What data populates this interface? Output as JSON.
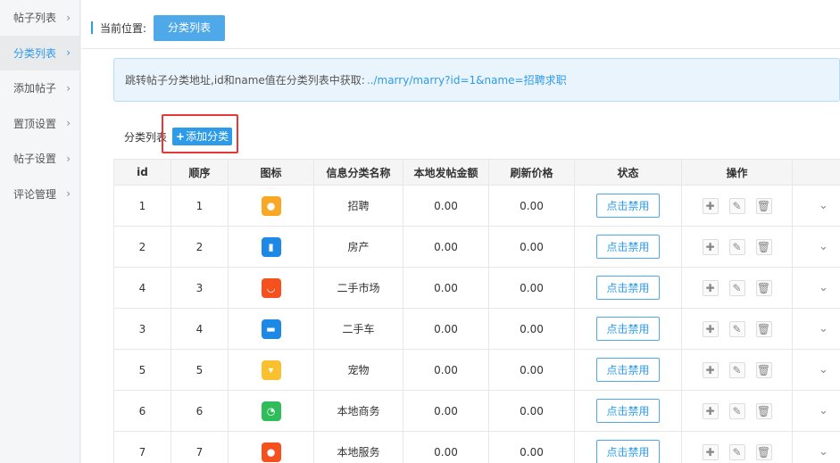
{
  "sidebar": {
    "items": [
      {
        "label": "帖子列表",
        "active": false
      },
      {
        "label": "分类列表",
        "active": true
      },
      {
        "label": "添加帖子",
        "active": false
      },
      {
        "label": "置顶设置",
        "active": false
      },
      {
        "label": "帖子设置",
        "active": false
      },
      {
        "label": "评论管理",
        "active": false
      }
    ],
    "chevron": "›"
  },
  "breadcrumb": {
    "label": "当前位置:",
    "current": "分类列表"
  },
  "notice": {
    "text": "跳转帖子分类地址,id和name值在分类列表中获取:",
    "path": "../marry/marry?id=1&name=招聘求职"
  },
  "list": {
    "label": "分类列表",
    "add_button": "添加分类",
    "add_icon": "+"
  },
  "table": {
    "headers": [
      "id",
      "顺序",
      "图标",
      "信息分类名称",
      "本地发帖金额",
      "刷新价格",
      "状态",
      "操作",
      ""
    ],
    "ban_label": "点击禁用",
    "rows": [
      {
        "id": "1",
        "order": "1",
        "icon": "briefcase-icon",
        "color": "#f9a825",
        "glyph": "●",
        "name": "招聘",
        "post_fee": "0.00",
        "refresh_price": "0.00"
      },
      {
        "id": "2",
        "order": "2",
        "icon": "house-icon",
        "color": "#1e88e5",
        "glyph": "▮",
        "name": "房产",
        "post_fee": "0.00",
        "refresh_price": "0.00"
      },
      {
        "id": "4",
        "order": "3",
        "icon": "shopping-bag-icon",
        "color": "#f4511e",
        "glyph": "◡",
        "name": "二手市场",
        "post_fee": "0.00",
        "refresh_price": "0.00"
      },
      {
        "id": "3",
        "order": "4",
        "icon": "car-icon",
        "color": "#1e88e5",
        "glyph": "▬",
        "name": "二手车",
        "post_fee": "0.00",
        "refresh_price": "0.00"
      },
      {
        "id": "5",
        "order": "5",
        "icon": "pet-icon",
        "color": "#fbc02d",
        "glyph": "▾",
        "name": "宠物",
        "post_fee": "0.00",
        "refresh_price": "0.00"
      },
      {
        "id": "6",
        "order": "6",
        "icon": "business-chart-icon",
        "color": "#2ebd5a",
        "glyph": "◔",
        "name": "本地商务",
        "post_fee": "0.00",
        "refresh_price": "0.00"
      },
      {
        "id": "7",
        "order": "7",
        "icon": "location-pin-icon",
        "color": "#f4511e",
        "glyph": "●",
        "name": "本地服务",
        "post_fee": "0.00",
        "refresh_price": "0.00"
      }
    ]
  },
  "ops": {
    "add": "✚",
    "edit": "✎",
    "delete": "🗑",
    "expand": "⌄"
  }
}
